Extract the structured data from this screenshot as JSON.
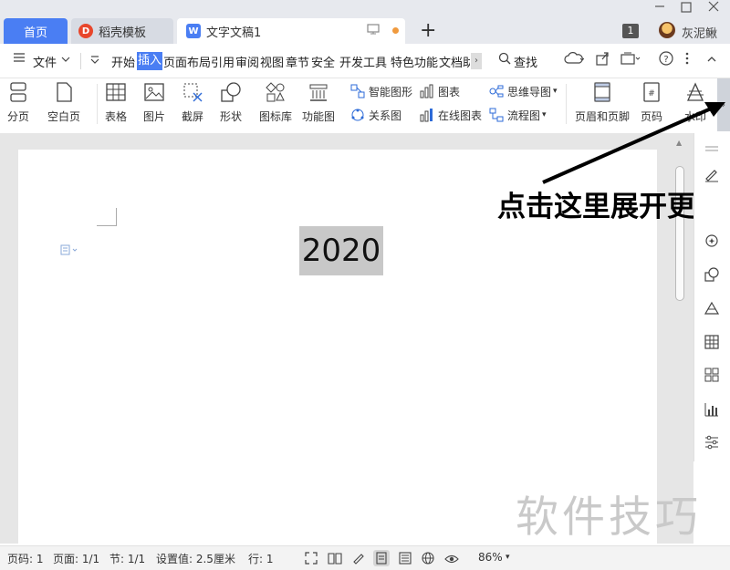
{
  "tabs": {
    "home": "首页",
    "docer": "稻壳模板",
    "document": "文字文稿1"
  },
  "topbar": {
    "badge_count": "1",
    "username": "灰泥鳅"
  },
  "menu": {
    "file": "文件",
    "items": [
      "开始",
      "插入",
      "页面布局",
      "引用",
      "审阅",
      "视图",
      "章节",
      "安全",
      "开发工具",
      "特色功能",
      "文档助"
    ],
    "active": "插入",
    "search": "查找"
  },
  "ribbon": {
    "page_break": "分页",
    "blank_page": "空白页",
    "table": "表格",
    "picture": "图片",
    "screenshot": "截屏",
    "shape": "形状",
    "icon_lib": "图标库",
    "func_chart": "功能图",
    "smart_shape": "智能图形",
    "relation_chart": "关系图",
    "chart": "图表",
    "online_chart": "在线图表",
    "mind_map": "思维导图",
    "flowchart": "流程图",
    "header_footer": "页眉和页脚",
    "page_number": "页码",
    "watermark": "水印"
  },
  "document": {
    "text": "2020"
  },
  "annotation": {
    "text": "点击这里展开更多"
  },
  "watermark_text": "软件技巧",
  "status": {
    "page_num": "页码: 1",
    "pages": "页面: 1/1",
    "section": "节: 1/1",
    "setting": "设置值: 2.5厘米",
    "line": "行: 1",
    "zoom": "86%"
  },
  "colors": {
    "accent": "#4a7ef3",
    "tabbar_bg": "#e7e9ee",
    "doc_bg": "#e6e6e6"
  }
}
